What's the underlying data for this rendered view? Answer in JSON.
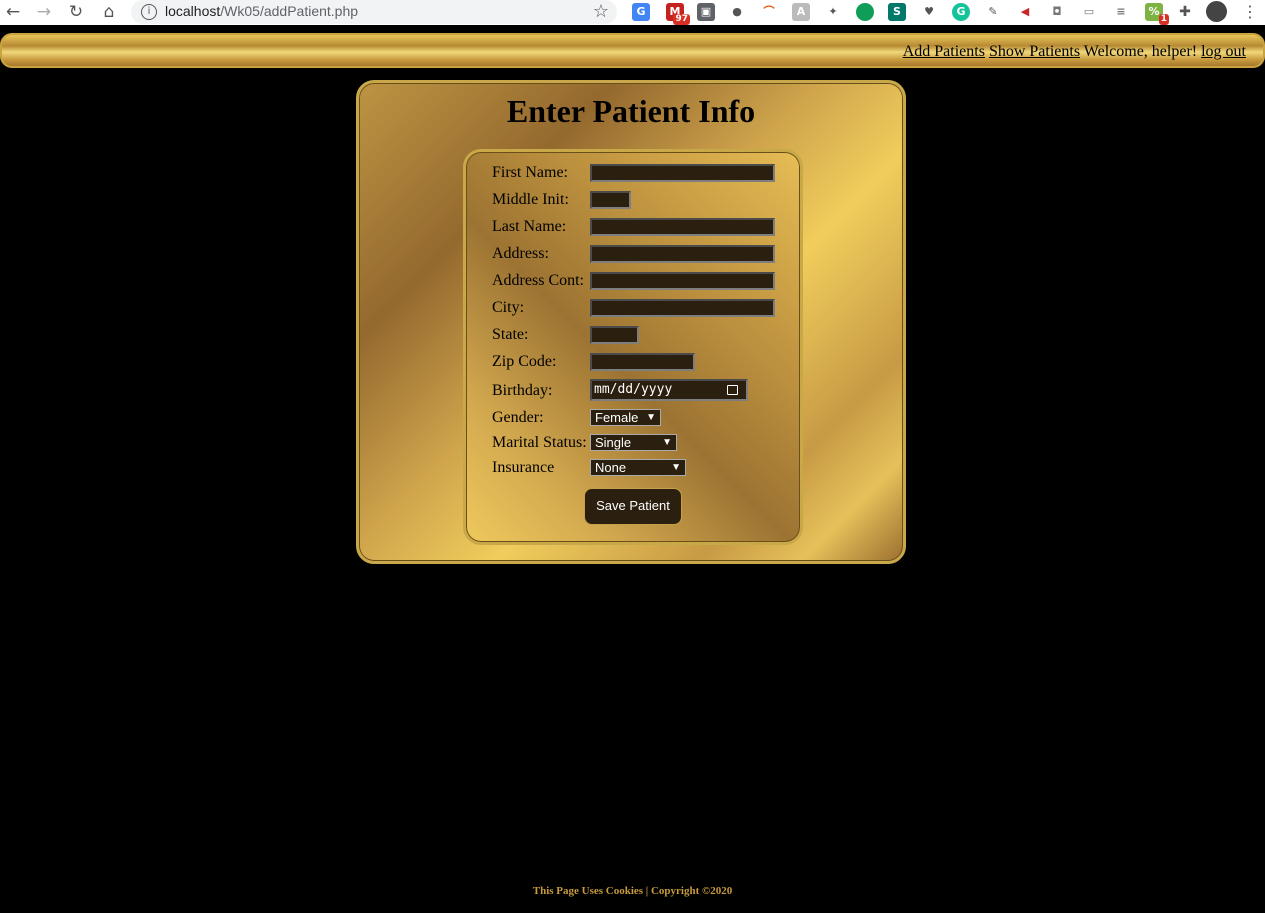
{
  "browser": {
    "url_host": "localhost",
    "url_path": "/Wk05/addPatient.php",
    "gmail_badge": "97",
    "ext_badge": "1"
  },
  "nav": {
    "add_patients": "Add Patients",
    "show_patients": "Show Patients",
    "welcome": "Welcome, helper!",
    "logout": "log out"
  },
  "page": {
    "title": "Enter Patient Info"
  },
  "form": {
    "labels": {
      "first_name": "First Name:",
      "middle_init": "Middle Init:",
      "last_name": "Last Name:",
      "address": "Address:",
      "address_cont": "Address Cont:",
      "city": "City:",
      "state": "State:",
      "zip": "Zip Code:",
      "birthday": "Birthday:",
      "gender": "Gender:",
      "marital": "Marital Status:",
      "insurance": "Insurance"
    },
    "birthday_placeholder": "mm/dd/yyyy",
    "gender_value": "Female",
    "marital_value": "Single",
    "insurance_value": "None",
    "save_label": "Save Patient"
  },
  "footer": {
    "text": "This Page Uses Cookies | Copyright ©2020"
  },
  "colors": {
    "gold": "#c9a43e",
    "field_bg": "#2b1f0f"
  }
}
